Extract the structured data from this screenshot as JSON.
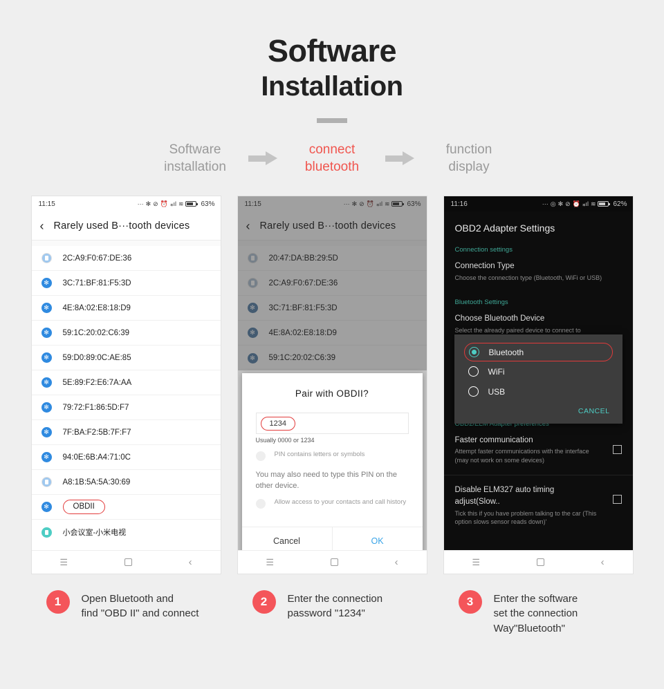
{
  "hero": {
    "line1": "Software",
    "line2": "Installation"
  },
  "flow": {
    "steps": [
      {
        "label": "Software\ninstallation",
        "active": false
      },
      {
        "label": "connect\nbluetooth",
        "active": true
      },
      {
        "label": "function\ndisplay",
        "active": false
      }
    ],
    "accent_color": "#f0564f"
  },
  "panel1": {
    "status": {
      "time": "11:15",
      "battery": "63%",
      "icons": "… bluetooth mute alarm signal wifi battery"
    },
    "appbar": {
      "back_icon": "chevron-left-icon",
      "title": "Rarely used B···tooth devices"
    },
    "devices": [
      {
        "name": "2C:A9:F0:67:DE:36",
        "icon": "phone"
      },
      {
        "name": "3C:71:BF:81:F5:3D",
        "icon": "bt"
      },
      {
        "name": "4E:8A:02:E8:18:D9",
        "icon": "bt"
      },
      {
        "name": "59:1C:20:02:C6:39",
        "icon": "bt"
      },
      {
        "name": "59:D0:89:0C:AE:85",
        "icon": "bt"
      },
      {
        "name": "5E:89:F2:E6:7A:AA",
        "icon": "bt"
      },
      {
        "name": "79:72:F1:86:5D:F7",
        "icon": "bt"
      },
      {
        "name": "7F:BA:F2:5B:7F:F7",
        "icon": "bt"
      },
      {
        "name": "94:0E:6B:A4:71:0C",
        "icon": "bt"
      },
      {
        "name": "A8:1B:5A:5A:30:69",
        "icon": "phone"
      },
      {
        "name": "OBDII",
        "icon": "bt",
        "highlight": true
      },
      {
        "name": "小会议室-小米电视",
        "icon": "tv",
        "cn": true
      }
    ],
    "nav": {
      "menu": "☰",
      "home": "home-square-icon",
      "back": "‹"
    }
  },
  "panel2": {
    "status": {
      "time": "11:15",
      "battery": "63%"
    },
    "appbar": {
      "title": "Rarely used B···tooth devices"
    },
    "devices": [
      {
        "name": "20:47:DA:BB:29:5D",
        "icon": "phone"
      },
      {
        "name": "2C:A9:F0:67:DE:36",
        "icon": "phone"
      },
      {
        "name": "3C:71:BF:81:F5:3D",
        "icon": "bt"
      },
      {
        "name": "4E:8A:02:E8:18:D9",
        "icon": "bt"
      },
      {
        "name": "59:1C:20:02:C6:39",
        "icon": "bt"
      }
    ],
    "dialog": {
      "title": "Pair with OBDII?",
      "pin_value": "1234",
      "pin_hint": "Usually 0000 or 1234",
      "check1": "PIN contains letters or symbols",
      "note": "You may also need to type this PIN on the other device.",
      "check2": "Allow access to your contacts and call history",
      "cancel": "Cancel",
      "ok": "OK"
    }
  },
  "panel3": {
    "status": {
      "time": "11:16",
      "battery": "62%"
    },
    "title": "OBD2 Adapter Settings",
    "sections": [
      {
        "header": "Connection settings",
        "items": [
          {
            "title": "Connection Type",
            "subtitle": "Choose the connection type (Bluetooth, WiFi or USB)",
            "checkbox": false
          }
        ]
      },
      {
        "header": "Bluetooth Settings",
        "items": [
          {
            "title": "Choose Bluetooth Device",
            "subtitle": "Select the already paired device to connect to",
            "checkbox": false
          }
        ]
      },
      {
        "header": "OBD2/ELM Adapter preferences",
        "items": [
          {
            "title": "Faster communication",
            "subtitle": "Attempt faster communications with the interface (may not work on some devices)",
            "checkbox": true
          },
          {
            "title": "Disable ELM327 auto timing adjust(Slow..",
            "subtitle": "Tick this if you have problem talking to the car (This option slows sensor reads down)'",
            "checkbox": true
          }
        ]
      }
    ],
    "radio_dialog": {
      "options": [
        {
          "label": "Bluetooth",
          "selected": true
        },
        {
          "label": "WiFi",
          "selected": false
        },
        {
          "label": "USB",
          "selected": false
        }
      ],
      "cancel": "CANCEL"
    },
    "accent_color": "#4ecdc4"
  },
  "captions": [
    {
      "num": "1",
      "text": "Open Bluetooth and\nfind \"OBD II\" and connect"
    },
    {
      "num": "2",
      "text": "Enter the connection\npassword \"1234\""
    },
    {
      "num": "3",
      "text": "Enter the software\nset the connection\nWay\"Bluetooth\""
    }
  ]
}
